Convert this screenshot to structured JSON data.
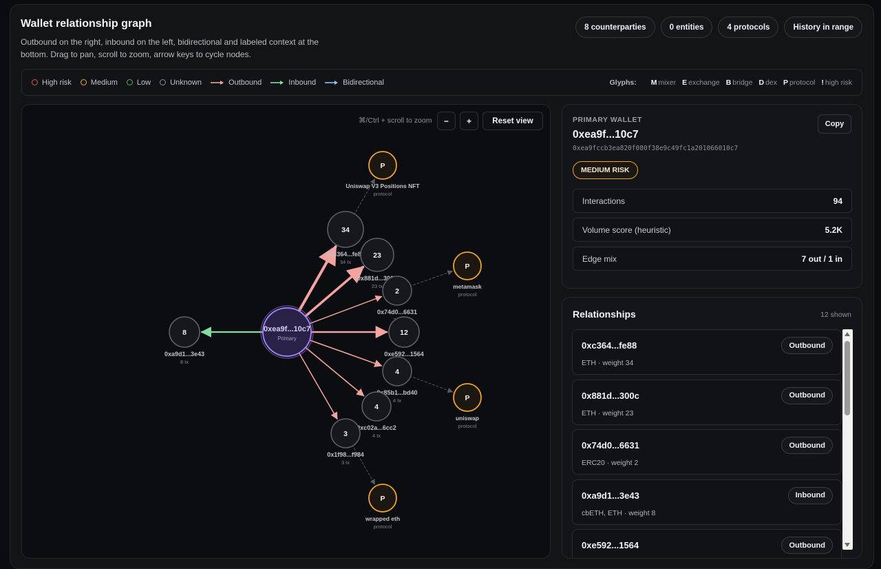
{
  "header": {
    "title": "Wallet relationship graph",
    "subtitle": "Outbound on the right, inbound on the left, bidirectional and labeled context at the bottom. Drag to pan, scroll to zoom, arrow keys to cycle nodes."
  },
  "chips": [
    "8 counterparties",
    "0 entities",
    "4 protocols",
    "History in range"
  ],
  "legend": {
    "items": [
      {
        "label": "High risk",
        "kind": "dot",
        "color": "#e2504f"
      },
      {
        "label": "Medium",
        "kind": "dot",
        "color": "#f0a42c"
      },
      {
        "label": "Low",
        "kind": "dot",
        "color": "#4fae6f"
      },
      {
        "label": "Unknown",
        "kind": "dot",
        "color": "#8a8d94"
      },
      {
        "label": "Outbound",
        "kind": "arrow",
        "color": "#f3a3a0"
      },
      {
        "label": "Inbound",
        "kind": "arrow",
        "color": "#7fe0a0"
      },
      {
        "label": "Bidirectional",
        "kind": "arrow",
        "color": "#8ec4f2"
      }
    ],
    "glyphs_title": "Glyphs:",
    "glyphs": [
      {
        "key": "M",
        "label": "mixer"
      },
      {
        "key": "E",
        "label": "exchange"
      },
      {
        "key": "B",
        "label": "bridge"
      },
      {
        "key": "D",
        "label": "dex"
      },
      {
        "key": "P",
        "label": "protocol"
      },
      {
        "key": "!",
        "label": "high risk"
      }
    ]
  },
  "graph": {
    "zoom_hint": "⌘/Ctrl + scroll to zoom",
    "zoom_out": "−",
    "zoom_in": "+",
    "reset": "Reset view",
    "center": {
      "label": "0xea9f...10c7",
      "sub": "Primary"
    },
    "counterparties": [
      {
        "id": "c1",
        "count": "34",
        "label": "0xc364...fe88",
        "sub": "34 tx",
        "dir": "out"
      },
      {
        "id": "c2",
        "count": "23",
        "label": "0x881d...300c",
        "sub": "23 tx",
        "dir": "out"
      },
      {
        "id": "c3",
        "count": "2",
        "label": "0x74d0...6631",
        "sub": "2 tx",
        "dir": "out"
      },
      {
        "id": "c4",
        "count": "12",
        "label": "0xe592...1564",
        "sub": "12 tx",
        "dir": "out"
      },
      {
        "id": "c5",
        "count": "4",
        "label": "0x85b1...bd40",
        "sub": "4 tx",
        "dir": "out"
      },
      {
        "id": "c6",
        "count": "4",
        "label": "0xc02a...6cc2",
        "sub": "4 tx",
        "dir": "out"
      },
      {
        "id": "c7",
        "count": "3",
        "label": "0x1f98...f984",
        "sub": "3 tx",
        "dir": "out"
      },
      {
        "id": "c8",
        "count": "8",
        "label": "0xa9d1...3e43",
        "sub": "8 tx",
        "dir": "in"
      }
    ],
    "protocols": [
      {
        "id": "p1",
        "glyph": "P",
        "label": "Uniswap V3 Positions NFT",
        "sub": "protocol",
        "link": "c1"
      },
      {
        "id": "p2",
        "glyph": "P",
        "label": "metamask",
        "sub": "protocol",
        "link": "c3"
      },
      {
        "id": "p3",
        "glyph": "P",
        "label": "uniswap",
        "sub": "protocol",
        "link": "c5"
      },
      {
        "id": "p4",
        "glyph": "P",
        "label": "wrapped eth",
        "sub": "protocol",
        "link": "c7"
      }
    ]
  },
  "primary": {
    "label": "PRIMARY WALLET",
    "name": "0xea9f...10c7",
    "full": "0xea9fccb3ea820f080f38e9c49fc1a201066010c7",
    "copy": "Copy",
    "risk": "MEDIUM RISK",
    "stats": [
      {
        "k": "Interactions",
        "v": "94"
      },
      {
        "k": "Volume score (heuristic)",
        "v": "5.2K"
      },
      {
        "k": "Edge mix",
        "v": "7 out / 1 in"
      }
    ]
  },
  "relationships": {
    "title": "Relationships",
    "count": "12 shown",
    "items": [
      {
        "addr": "0xc364...fe88",
        "meta": "ETH · weight 34",
        "dir": "Outbound"
      },
      {
        "addr": "0x881d...300c",
        "meta": "ETH · weight 23",
        "dir": "Outbound"
      },
      {
        "addr": "0x74d0...6631",
        "meta": "ERC20 · weight 2",
        "dir": "Outbound"
      },
      {
        "addr": "0xa9d1...3e43",
        "meta": "cbETH, ETH · weight 8",
        "dir": "Inbound"
      },
      {
        "addr": "0xe592...1564",
        "meta": "",
        "dir": "Outbound"
      }
    ]
  }
}
